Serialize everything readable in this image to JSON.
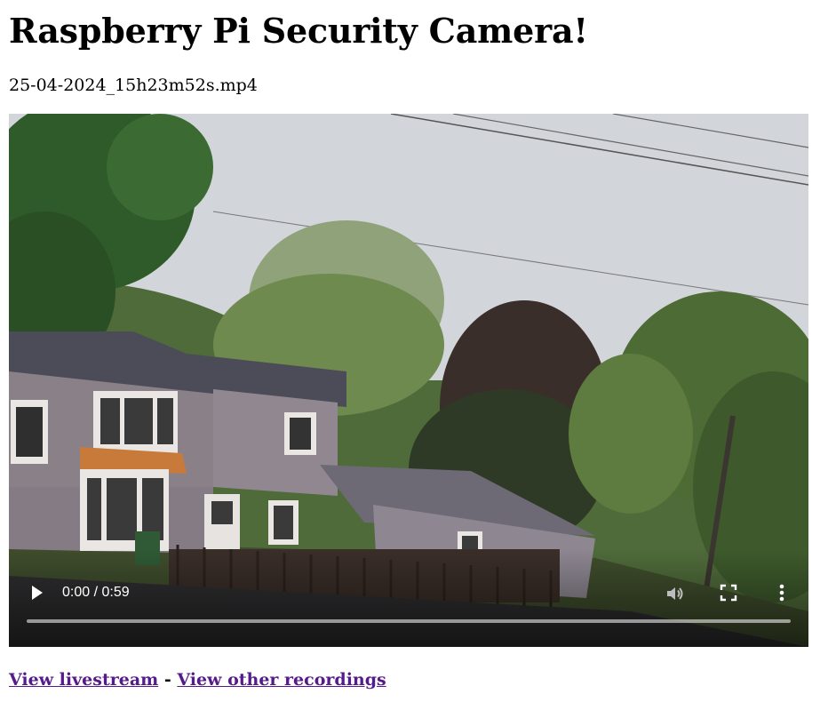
{
  "page": {
    "title": "Raspberry Pi Security Camera!",
    "filename": "25-04-2024_15h23m52s.mp4"
  },
  "video": {
    "time_display": "0:00 / 0:59",
    "progress_fraction": 0.0,
    "icons": {
      "play": "play-icon",
      "volume": "volume-icon",
      "fullscreen": "fullscreen-icon",
      "more": "more-options-icon"
    }
  },
  "links": {
    "livestream_label": "View livestream",
    "separator": "-",
    "recordings_label": "View other recordings"
  },
  "colors": {
    "link_visited": "#551a8b",
    "sky": "#c9ccd0",
    "house_siding": "#8a8088",
    "roof": "#4a4a55"
  }
}
